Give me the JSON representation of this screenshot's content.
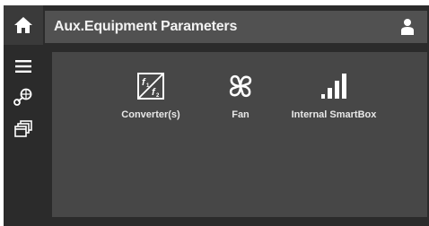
{
  "header": {
    "title": "Aux.Equipment Parameters",
    "home_icon": "home-icon",
    "user_icon": "user-icon"
  },
  "sidebar": {
    "items": [
      {
        "icon": "menu-icon"
      },
      {
        "icon": "components-icon"
      },
      {
        "icon": "windows-stack-icon"
      }
    ]
  },
  "tiles": [
    {
      "label": "Converter(s)",
      "icon": "frequency-converter-icon"
    },
    {
      "label": "Fan",
      "icon": "fan-icon"
    },
    {
      "label": "Internal SmartBox",
      "icon": "signal-bars-icon"
    }
  ],
  "colors": {
    "background": "#2b2b2b",
    "titlebar": "#515151",
    "content_panel": "#474747",
    "text": "#f2f2f2",
    "icon": "#ffffff"
  }
}
